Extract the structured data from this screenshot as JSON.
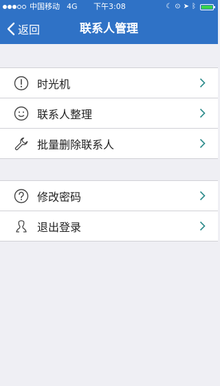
{
  "status_bar": {
    "carrier": "中国移动",
    "network": "4G",
    "time": "下午3:08"
  },
  "nav": {
    "back_label": "返回",
    "title": "联系人管理"
  },
  "groups": [
    {
      "items": [
        {
          "label": "时光机",
          "icon": "exclamation-circle-icon"
        },
        {
          "label": "联系人整理",
          "icon": "smiley-icon"
        },
        {
          "label": "批量删除联系人",
          "icon": "wrench-icon"
        }
      ]
    },
    {
      "items": [
        {
          "label": "修改密码",
          "icon": "question-circle-icon"
        },
        {
          "label": "退出登录",
          "icon": "logout-user-icon"
        }
      ]
    }
  ],
  "colors": {
    "header": "#2f72c6",
    "background": "#efeff4",
    "chevron": "#2a8a8a"
  }
}
